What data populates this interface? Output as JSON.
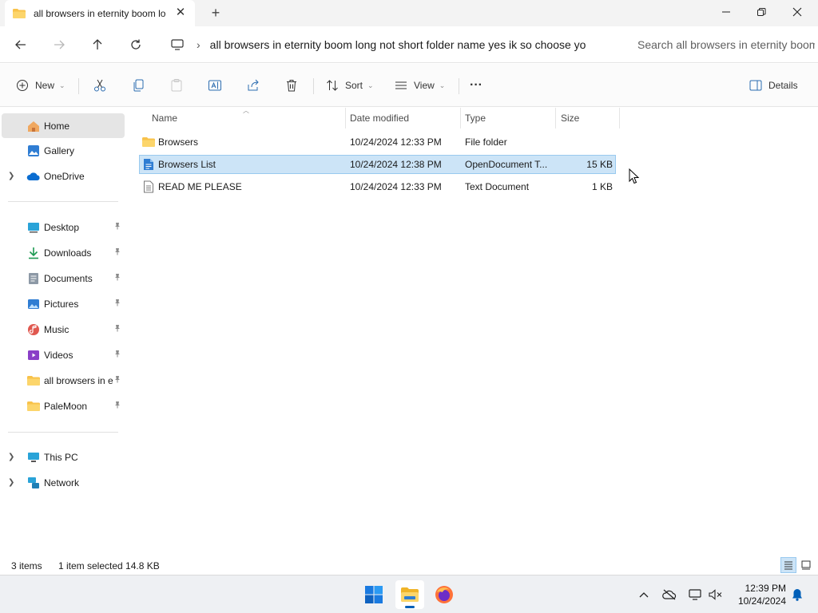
{
  "window": {
    "tab_title": "all browsers in eternity boom long not short folder name yes ik so choose yo",
    "new_tab_symbol": "+",
    "close_tab_symbol": "✕"
  },
  "address": {
    "path": "all browsers in eternity boom long not short folder name yes ik so choose yo",
    "search_placeholder": "Search all browsers in eternity boom long not short folder name yes ik so choose yo"
  },
  "toolbar": {
    "new_label": "New",
    "sort_label": "Sort",
    "view_label": "View",
    "more_label": "···",
    "details_label": "Details"
  },
  "sidebar": {
    "home": "Home",
    "gallery": "Gallery",
    "onedrive": "OneDrive",
    "quick_access": [
      {
        "label": "Desktop",
        "icon": "desktop-icon"
      },
      {
        "label": "Downloads",
        "icon": "downloads-icon"
      },
      {
        "label": "Documents",
        "icon": "documents-icon"
      },
      {
        "label": "Pictures",
        "icon": "pictures-icon"
      },
      {
        "label": "Music",
        "icon": "music-icon"
      },
      {
        "label": "Videos",
        "icon": "videos-icon"
      },
      {
        "label": "all browsers in eternity boom long not short folder name yes ik so choose yo",
        "icon": "folder-icon"
      },
      {
        "label": "PaleMoon",
        "icon": "folder-icon"
      }
    ],
    "this_pc": "This PC",
    "network": "Network"
  },
  "columns": {
    "name": "Name",
    "date": "Date modified",
    "type": "Type",
    "size": "Size"
  },
  "files": [
    {
      "name": "Browsers",
      "date": "10/24/2024 12:33 PM",
      "type": "File folder",
      "size": "",
      "icon": "folder-icon",
      "selected": false
    },
    {
      "name": "Browsers List",
      "date": "10/24/2024 12:38 PM",
      "type": "OpenDocument T...",
      "size": "15 KB",
      "icon": "odt-document-icon",
      "selected": true
    },
    {
      "name": "READ ME PLEASE",
      "date": "10/24/2024 12:33 PM",
      "type": "Text Document",
      "size": "1 KB",
      "icon": "text-document-icon",
      "selected": false
    }
  ],
  "status": {
    "item_count": "3 items",
    "selection": "1 item selected  14.8 KB"
  },
  "taskbar": {
    "time": "12:39 PM",
    "date": "10/24/2024"
  },
  "colors": {
    "accent": "#005fb8",
    "selection_bg": "#cce4f7",
    "selection_border": "#99c9ef",
    "folder_yellow": "#f8c24a"
  }
}
